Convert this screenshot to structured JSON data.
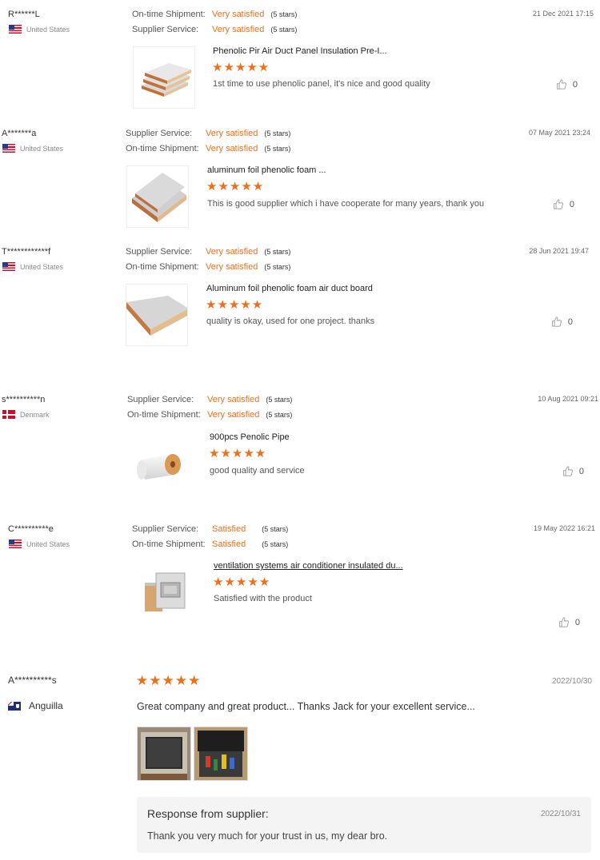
{
  "reviews": [
    {
      "user": "R******L",
      "country": "United States",
      "rating1": {
        "label": "On-time Shipment:",
        "value": "Very satisfied",
        "stars": "(5 stars)"
      },
      "rating2": {
        "label": "Supplier Service:",
        "value": "Very satisfied",
        "stars": "(5 stars)"
      },
      "date": "21 Dec 2021 17:15",
      "product": "Phenolic Pir Air Duct Panel Insulation Pre-I...",
      "stars": "★★★★★",
      "comment": "1st time to use phenolic panel, it's nice and good quality",
      "likes": "0"
    },
    {
      "user": "A*******a",
      "country": "United States",
      "rating1": {
        "label": "Supplier Service:",
        "value": "Very satisfied",
        "stars": "(5 stars)"
      },
      "rating2": {
        "label": "On-time Shipment:",
        "value": "Very satisfied",
        "stars": "(5 stars)"
      },
      "date": "07 May 2021 23:24",
      "product": "aluminum foil phenolic foam ...",
      "stars": "★★★★★",
      "comment": "This is good supplier which i have cooperate for many years, thank you",
      "likes": "0"
    },
    {
      "user": "T************f",
      "country": "United States",
      "rating1": {
        "label": "Supplier Service:",
        "value": "Very satisfied",
        "stars": "(5 stars)"
      },
      "rating2": {
        "label": "On-time Shipment:",
        "value": "Very satisfied",
        "stars": "(5 stars)"
      },
      "date": "28 Jun 2021 19:47",
      "product": "Aluminum foil phenolic foam air duct board",
      "stars": "★★★★★",
      "comment": "quality is okay, used for one project. thanks",
      "likes": "0"
    },
    {
      "user": "s**********n",
      "country": "Denmark",
      "rating1": {
        "label": "Supplier Service:",
        "value": "Very satisfied",
        "stars": "(5 stars)"
      },
      "rating2": {
        "label": "On-time Shipment:",
        "value": "Very satisfied",
        "stars": "(5 stars)"
      },
      "date": "10 Aug 2021 09:21",
      "product": "900pcs Penolic  Pipe",
      "stars": "★★★★★",
      "comment": "good quality and service",
      "likes": "0"
    },
    {
      "user": "C**********e",
      "country": "United States",
      "rating1": {
        "label": "Supplier Service:",
        "value": "Satisfied",
        "stars": "(5 stars)"
      },
      "rating2": {
        "label": "On-time Shipment:",
        "value": "Satisfied",
        "stars": "(5 stars)"
      },
      "date": "19 May 2022 16:21",
      "product": "ventilation systems air conditioner insulated du...",
      "stars": "★★★★★",
      "comment": "Satisfied with the product",
      "likes": "0"
    }
  ],
  "last_review": {
    "user": "A**********s",
    "country": "Anguilla",
    "stars": "★★★★★",
    "date": "2022/10/30",
    "comment": "Great company and great product... Thanks Jack for your excellent service...",
    "response_title": "Response from supplier:",
    "response_date": "2022/10/31",
    "response_text": "Thank you very much for your trust in us, my dear bro."
  },
  "colors": {
    "accent": "#f06e1a",
    "text": "#333333",
    "muted": "#888888",
    "response_bg": "#f4f4f4"
  },
  "icons": {
    "like": "thumbs-up-icon",
    "us_flag": "us-flag-icon",
    "dk_flag": "denmark-flag-icon",
    "ai_flag": "anguilla-flag-icon"
  }
}
